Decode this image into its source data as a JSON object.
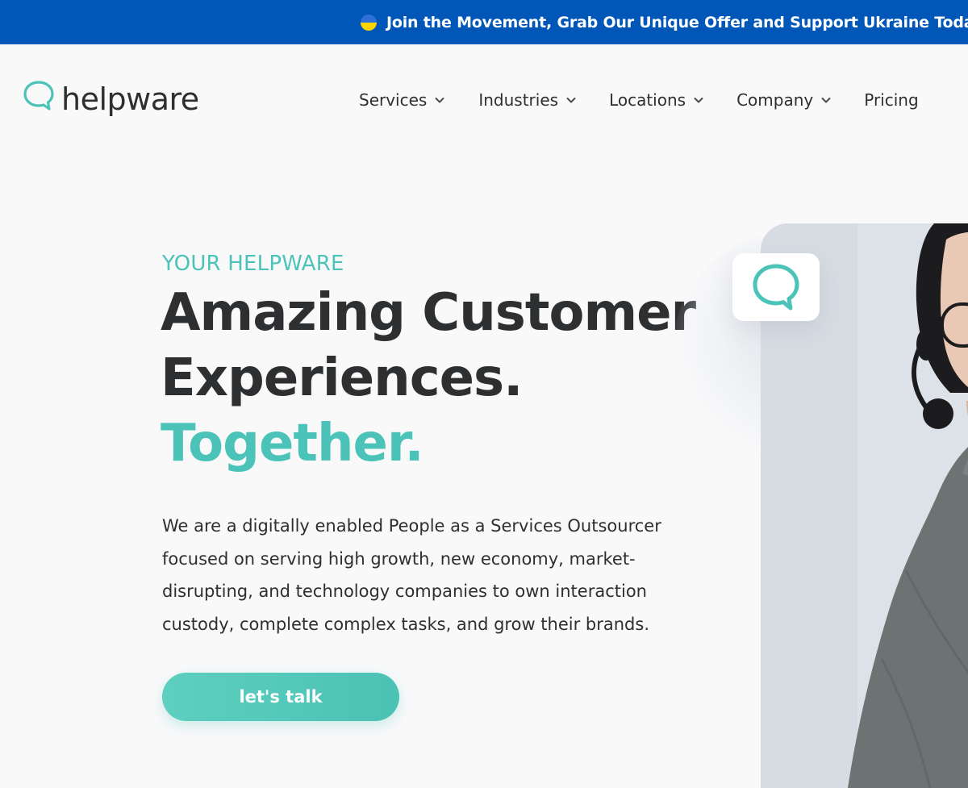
{
  "announcement": {
    "text": "Join the Movement, Grab Our Unique Offer and Support Ukraine Today",
    "flag_icon": "ukraine-flag-icon",
    "background": "#0057b7"
  },
  "header": {
    "logo_text": "helpware",
    "logo_icon": "chat-bubble-icon",
    "nav": [
      {
        "label": "Services",
        "has_dropdown": true
      },
      {
        "label": "Industries",
        "has_dropdown": true
      },
      {
        "label": "Locations",
        "has_dropdown": true
      },
      {
        "label": "Company",
        "has_dropdown": true
      },
      {
        "label": "Pricing",
        "has_dropdown": false
      }
    ]
  },
  "hero": {
    "eyebrow": "YOUR HELPWARE",
    "headline_line1": "Amazing Customer",
    "headline_line2": "Experiences.",
    "headline_accent": "Together.",
    "description": "We are a digitally enabled People as a Services Outsourcer focused on serving high growth, new economy, market-disrupting, and technology companies to own interaction custody, complete complex tasks, and grow their brands.",
    "cta_label": "let's talk",
    "badge_icon": "chat-bubble-icon",
    "image_subject": "customer-support-agent-with-headset"
  },
  "colors": {
    "accent": "#4cc3b8",
    "text": "#2d2f31",
    "page_background": "#f9f9fa",
    "banner": "#0057b7"
  }
}
